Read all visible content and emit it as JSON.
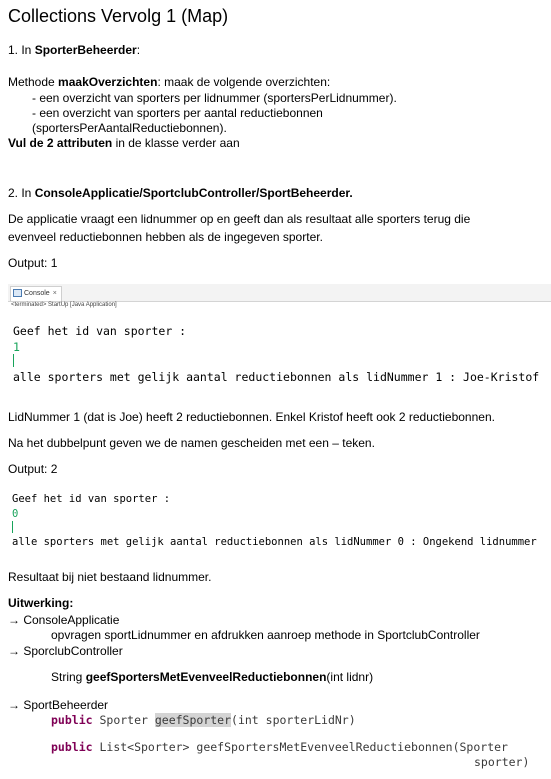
{
  "title": "Collections Vervolg 1  (Map)",
  "section1": {
    "heading_prefix": "1.  In ",
    "heading_bold": "SporterBeheerder",
    "heading_suffix": ":",
    "methode_prefix": "Methode ",
    "methode_bold": "maakOverzichten",
    "methode_suffix": ": maak de volgende overzichten:",
    "bullet1": "- een overzicht van sporters per lidnummer (sportersPerLidnummer).",
    "bullet2a": "- een overzicht van sporters per aantal reductiebonnen",
    "bullet2b": "(sportersPerAantalReductiebonnen).",
    "vul_bold": "Vul de 2 attributen",
    "vul_rest": " in de klasse verder aan"
  },
  "section2": {
    "heading_prefix": "2.  In ",
    "heading_bold": "ConsoleApplicatie/SportclubController/SportBeheerder.",
    "desc_line1": "De applicatie vraagt een lidnummer op en geeft dan als resultaat alle sporters terug die",
    "desc_line2": "evenveel  reductiebonnen hebben als de ingegeven sporter.",
    "output1_label": "Output:  1",
    "console1": {
      "tab_label": "Console",
      "tab_close": "×",
      "terminated": "<terminated> StartUp [Java Application]",
      "prompt": "Geef het id van sporter :",
      "input": "1",
      "result": "alle sporters met gelijk aantal reductiebonnen als lidNummer 1 : Joe-Kristof"
    },
    "explain1": "LidNummer 1  (dat is Joe) heeft 2 reductiebonnen. Enkel Kristof heeft ook 2 reductiebonnen.",
    "explain2": "Na het dubbelpunt geven we de namen gescheiden met een – teken.",
    "output2_label": "Output:  2",
    "console2": {
      "prompt": "Geef het id van sporter :",
      "input": "0",
      "result": "alle sporters met gelijk aantal reductiebonnen als lidNummer 0 : Ongekend lidnummer"
    },
    "resultaat": "Resultaat bij niet bestaand lidnummer."
  },
  "uitwerking": {
    "heading": "Uitwerking:",
    "arrow": "→",
    "item1_label": " ConsoleApplicatie",
    "item1_detail": "opvragen sportLidnummer en afdrukken aanroep methode in SportclubController",
    "item2_label": " SporclubController",
    "item2_sig_prefix": "String ",
    "item2_sig_bold": "geefSportersMetEvenveelReductiebonnen",
    "item2_sig_suffix": "(int lidnr)",
    "item3_label": " SportBeheerder",
    "code1_kw": "public",
    "code1_type": " Sporter ",
    "code1_method": "geefSporter",
    "code1_rest": "(int sporterLidNr)",
    "code2_kw": "public",
    "code2_rest": " List<Sporter> geefSportersMetEvenveelReductiebonnen(Sporter",
    "code2_cont": "sporter)"
  }
}
